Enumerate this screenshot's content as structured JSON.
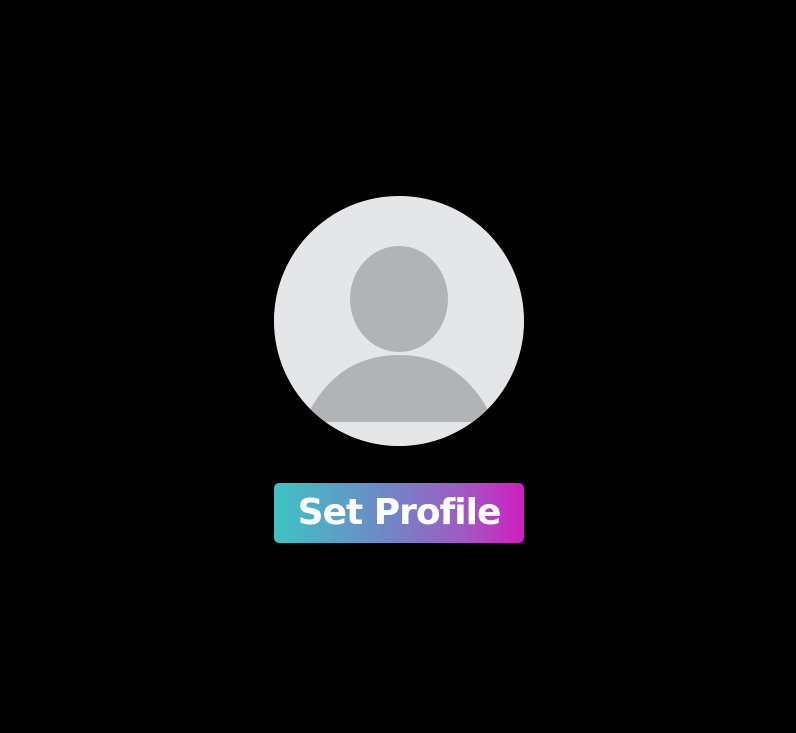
{
  "avatar": {
    "icon": "default-user-silhouette-icon",
    "background_color": "#e4e6e8",
    "silhouette_color": "#b0b4b7"
  },
  "profile_button": {
    "label": "Set Profile",
    "gradient_start_color": "#3fc3c4",
    "gradient_end_color": "#d01ec0",
    "text_color": "#ffffff"
  },
  "page": {
    "background_color": "#000000"
  }
}
